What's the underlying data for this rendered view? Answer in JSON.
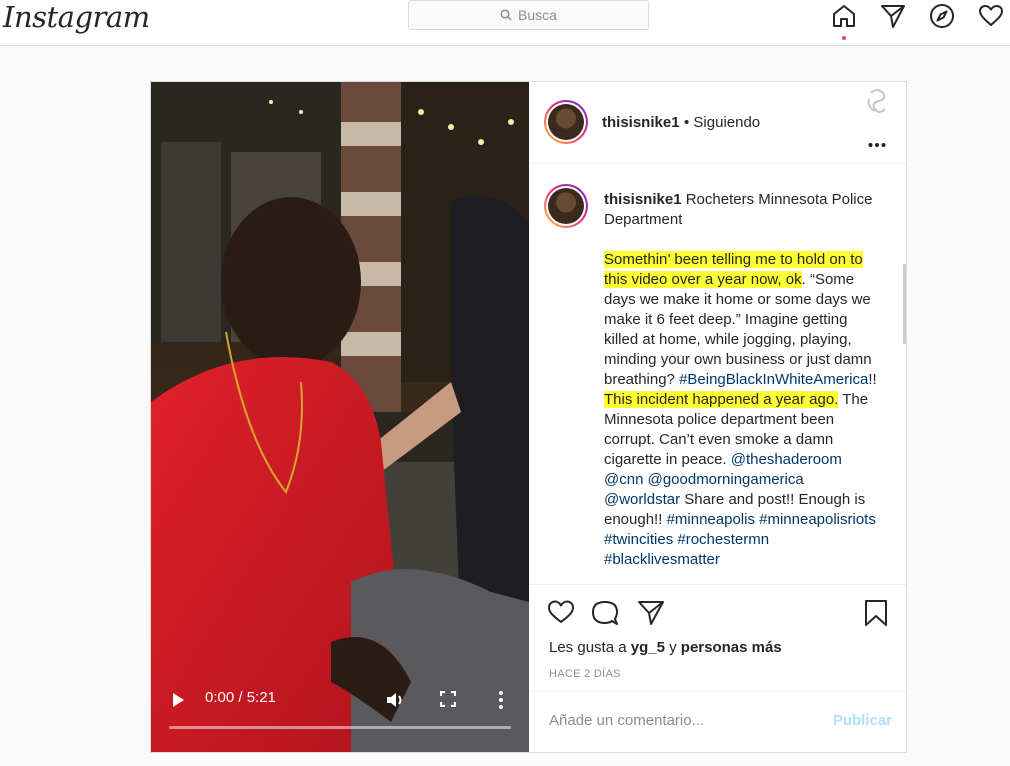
{
  "app": {
    "logo": "Instagram"
  },
  "search": {
    "placeholder": "Busca"
  },
  "video": {
    "timecode": "0:00 / 5:21",
    "progress": 0
  },
  "post": {
    "username": "thisisnike1",
    "follow_status": "• Siguiendo",
    "caption_username": "thisisnike1",
    "caption_title": "Rocheters Minnesota Police Department",
    "caption": {
      "hl1": "Somethin’ been telling me to hold on to this video over a year now, ok",
      "t1": ". “Some days we make it home or some days we make it 6 feet deep.” Imagine getting killed at home, while jogging, playing, minding your own business or just damn breathing? ",
      "tag1": "#BeingBlackInWhiteAmerica",
      "t2": "!! ",
      "hl2": "This incident happened a year ago.",
      "t3": " The Minnesota police department been corrupt. Can’t even smoke a damn cigarette in peace. ",
      "tag2": "@theshaderoom",
      "t4": " ",
      "tag3": "@cnn",
      "t5": " ",
      "tag4": "@goodmorningamerica",
      "t6": " ",
      "tag5": "@worldstar",
      "t7": " Share and post!! Enough is enough!! ",
      "tag6": "#minneapolis",
      "t8": " ",
      "tag7": "#minneapolisriots",
      "t9": " ",
      "tag8": "#twincities",
      "t10": " ",
      "tag9": "#rochestermn",
      "t11": " ",
      "tag10": "#blacklivesmatter"
    },
    "likes_prefix": "Les gusta a",
    "likes_user": "yg_5",
    "likes_and": "y",
    "likes_others": "personas más",
    "time_ago": "HACE 2 DÍAS",
    "comment_placeholder": "Añade un comentario...",
    "publish_label": "Publicar"
  },
  "colors": {
    "highlight": "#ffff33",
    "link": "#00376b",
    "publish": "#b2dffc",
    "notif_dot": "#ed4956"
  }
}
